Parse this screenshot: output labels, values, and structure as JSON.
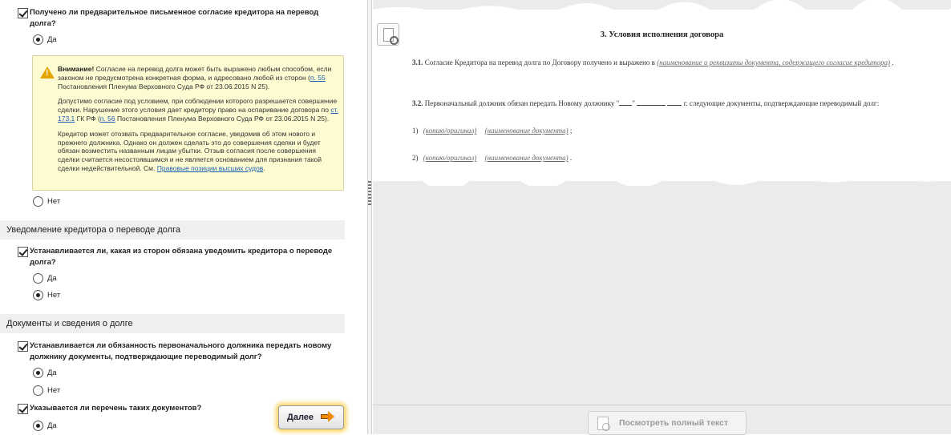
{
  "left": {
    "q1": {
      "text": "Получено ли предварительное письменное согласие кредитора на перевод долга?"
    },
    "q1_opt_yes": "Да",
    "q1_opt_no": "Нет",
    "warning": {
      "title": "Внимание!",
      "p1_a": "Согласие на перевод долга может быть выражено любым способом, если законом не предусмотрена конкретная форма, и адресовано любой из сторон (",
      "p1_link": "п. 55",
      "p1_b": " Постановления Пленума Верховного Суда РФ от 23.06.2015 N 25).",
      "p2_a": "Допустимо согласие под условием, при соблюдении которого разрешается совершение сделки. Нарушение этого условия дает кредитору право на оспаривание договора по ",
      "p2_link1": "ст. 173.1",
      "p2_b": " ГК РФ (",
      "p2_link2": "п. 56",
      "p2_c": " Постановления Пленума Верховного Суда РФ от 23.06.2015 N 25).",
      "p3_a": "Кредитор может отозвать предварительное согласие, уведомив об этом нового и прежнего должника. Однако он должен сделать это до совершения сделки и будет обязан возместить названным лицам убытки. Отзыв согласия после совершения сделки считается несостоявшимся и не является основанием для признания такой сделки недействительной. См. ",
      "p3_link": "Правовые позиции высших судов",
      "p3_b": "."
    },
    "section1": "Уведомление кредитора о переводе долга",
    "q2": {
      "text": "Устанавливается ли, какая из сторон обязана уведомить кредитора о переводе долга?"
    },
    "q2_opt_yes": "Да",
    "q2_opt_no": "Нет",
    "section2": "Документы и сведения о долге",
    "q3": {
      "text": "Устанавливается ли обязанность первоначального должника передать новому должнику документы, подтверждающие переводимый долг?"
    },
    "q3_opt_yes": "Да",
    "q3_opt_no": "Нет",
    "q4": {
      "text": "Указывается ли перечень таких документов?"
    },
    "q4_opt_yes": "Да",
    "next_label": "Далее"
  },
  "right": {
    "title": "3.  Условия исполнения договора",
    "p31_num": "3.1.",
    "p31_text": " Согласие Кредитора на перевод долга по Договору получено и выражено в ",
    "p31_field": "(наименование и реквизиты документа, содержащего согласие кредитора)",
    "p32_num": "3.2.",
    "p32_text": " Первоначальный должник обязан передать Новому должнику \"",
    "p32_text_b": "\"",
    "p32_text_c": " г. следующие документы, подтверждающие переводимый долг:",
    "item1_num": "1)",
    "item2_num": "2)",
    "field_copy": "(копию/оригинал)",
    "field_docname": "(наименование документа)",
    "item1_end": ";",
    "item2_end": ".",
    "fulltext_label": "Посмотреть полный текст"
  },
  "colors": {
    "accent_glow": "#ffd25a",
    "link": "#1a5fb4",
    "warning_bg": "#fdfbd2"
  }
}
